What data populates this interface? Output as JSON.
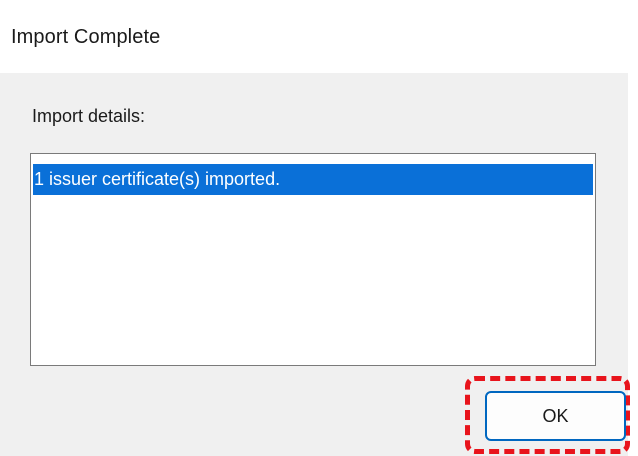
{
  "window": {
    "title": "Import Complete"
  },
  "content": {
    "details_label": "Import details:",
    "list_items": [
      "1 issuer certificate(s) imported."
    ]
  },
  "buttons": {
    "ok_label": "OK"
  },
  "colors": {
    "selection": "#0a70d8",
    "highlight_annotation": "#e8141c",
    "button_border": "#0067c0"
  }
}
